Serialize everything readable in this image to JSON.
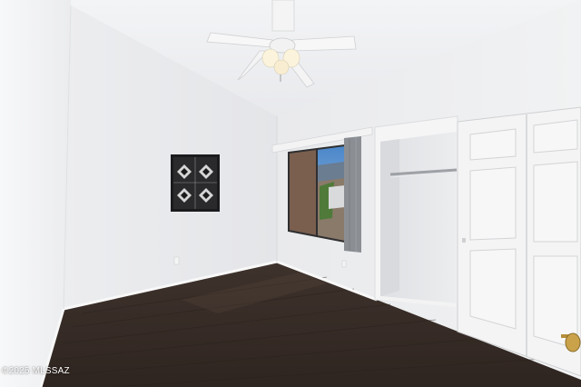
{
  "photo": {
    "subject": "empty-bedroom",
    "watermark_text": "©2025 MLSSAZ"
  },
  "colors": {
    "wall": "#eeeff1",
    "ceiling": "#f1f2f4",
    "floor": "#3a2e28",
    "baseboard": "#f6f6f6",
    "door": "#f4f4f4",
    "curtain": "#8b8f94",
    "knob": "#c9a24a"
  },
  "icons": {
    "ceiling_fan": "ceiling-fan",
    "wall_art": "framed-quilt-art"
  }
}
